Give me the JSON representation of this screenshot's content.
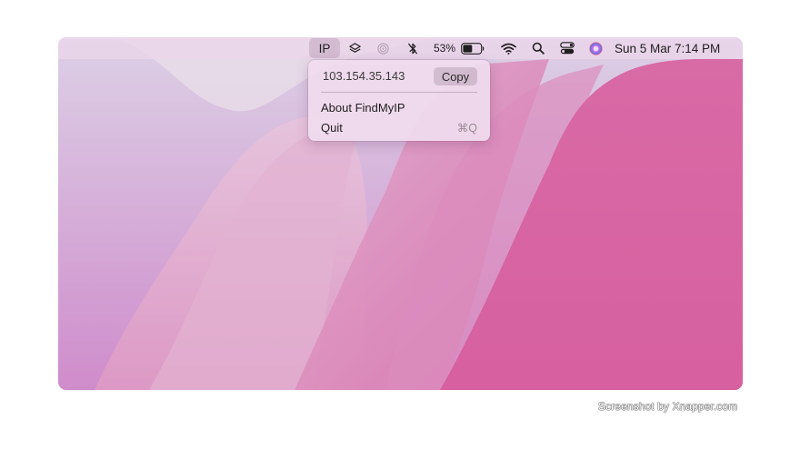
{
  "menubar": {
    "app_label": "IP",
    "battery_percent_label": "53%",
    "battery_level": 0.53,
    "clock": "Sun 5 Mar  7:14 PM",
    "icons": [
      "layers-icon",
      "airdrop-icon",
      "bluetooth-off-icon",
      "battery-icon",
      "wifi-icon",
      "search-icon",
      "control-center-icon",
      "siri-icon"
    ]
  },
  "menu": {
    "ip_address": "103.154.35.143",
    "copy_label": "Copy",
    "items": [
      {
        "label": "About FindMyIP",
        "shortcut": ""
      },
      {
        "label": "Quit",
        "shortcut": "⌘Q"
      }
    ]
  },
  "caption": "Screenshot by Xnapper.com",
  "colors": {
    "wallpaper_pink": "#d8619c",
    "wallpaper_light": "#e5d3e4",
    "menubar_bg": "#ecd6ea"
  }
}
